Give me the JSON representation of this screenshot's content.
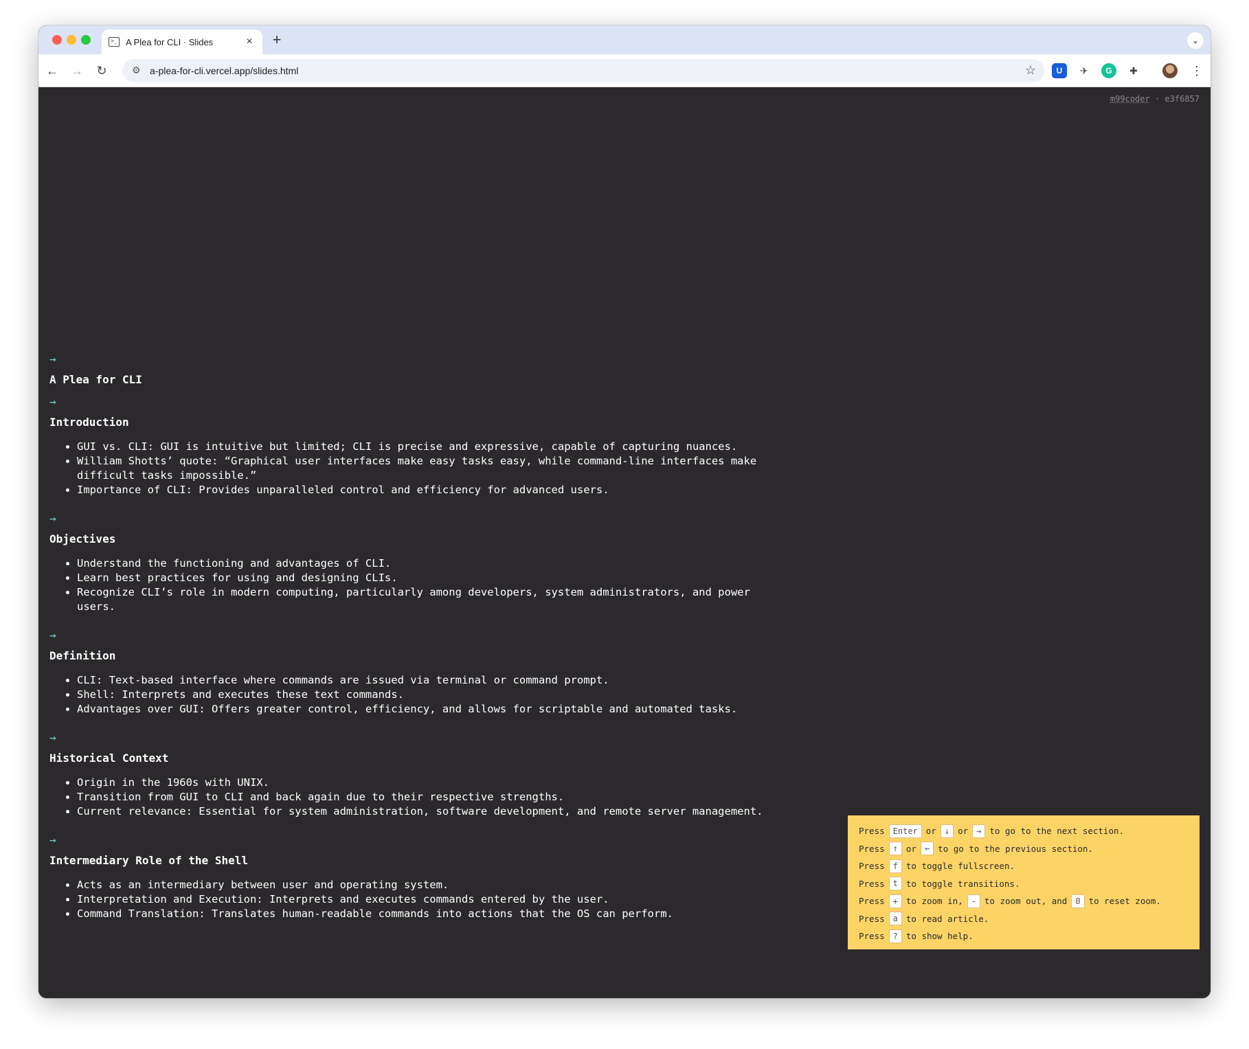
{
  "browser": {
    "tab_title": "A Plea for CLI · Slides",
    "url": "a-plea-for-cli.vercel.app/slides.html"
  },
  "author": {
    "handle": "m99coder",
    "separator": "·",
    "commit": "e3f6857"
  },
  "arrow_glyph": "→",
  "title_section": {
    "title": "A Plea for CLI"
  },
  "sections": [
    {
      "title": "Introduction",
      "items": [
        "GUI vs. CLI: GUI is intuitive but limited; CLI is precise and expressive, capable of capturing nuances.",
        "William Shotts’ quote: “Graphical user interfaces make easy tasks easy, while command-line interfaces make difficult tasks impossible.”",
        "Importance of CLI: Provides unparalleled control and efficiency for advanced users."
      ]
    },
    {
      "title": "Objectives",
      "items": [
        "Understand the functioning and advantages of CLI.",
        "Learn best practices for using and designing CLIs.",
        "Recognize CLI’s role in modern computing, particularly among developers, system administrators, and power users."
      ]
    },
    {
      "title": "Definition",
      "items": [
        "CLI: Text-based interface where commands are issued via terminal or command prompt.",
        "Shell: Interprets and executes these text commands.",
        "Advantages over GUI: Offers greater control, efficiency, and allows for scriptable and automated tasks."
      ]
    },
    {
      "title": "Historical Context",
      "items": [
        "Origin in the 1960s with UNIX.",
        "Transition from GUI to CLI and back again due to their respective strengths.",
        "Current relevance: Essential for system administration, software development, and remote server management."
      ]
    },
    {
      "title": "Intermediary Role of the Shell",
      "items": [
        "Acts as an intermediary between user and operating system.",
        "Interpretation and Execution: Interprets and executes commands entered by the user.",
        "Command Translation: Translates human-readable commands into actions that the OS can perform."
      ]
    }
  ],
  "help": {
    "press": "Press",
    "or": "or",
    "and": "and",
    "rows": {
      "next": {
        "keys": [
          "Enter",
          "↓",
          "→"
        ],
        "text": "to go to the next section."
      },
      "prev": {
        "keys": [
          "↑",
          "←"
        ],
        "text": "to go to the previous section."
      },
      "fullscreen": {
        "key": "f",
        "text": "to toggle fullscreen."
      },
      "transitions": {
        "key": "t",
        "text": "to toggle transitions."
      },
      "zoom": {
        "keys": [
          "+",
          "-",
          "0"
        ],
        "text_in": "to zoom in,",
        "text_out": "to zoom out,",
        "text_reset": "to reset zoom."
      },
      "article": {
        "key": "a",
        "text": "to read article."
      },
      "help": {
        "key": "?",
        "text": "to show help."
      }
    }
  }
}
